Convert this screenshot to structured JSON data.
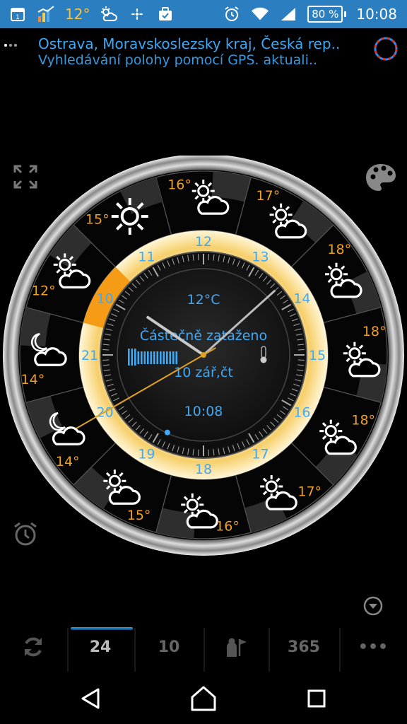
{
  "status_bar": {
    "notification_icons": [
      "calendar-icon",
      "weather-chart-icon",
      "fan-icon",
      "briefcase-icon"
    ],
    "temperature": "12°",
    "battery": "80 %",
    "time": "10:08"
  },
  "header": {
    "location": "Ostrava, Moravskoslezsky kraj, Česká rep..",
    "subtitle": "Vyhledávání polohy pomocí GPS. aktuali..",
    "page_count": 3,
    "active_page": 1
  },
  "clock": {
    "temperature": "12°C",
    "condition": "Částečně zataženo",
    "date": "10 zář,čt",
    "digital_time": "10:08",
    "hour_labels": [
      "12",
      "13",
      "14",
      "15",
      "16",
      "17",
      "18",
      "19",
      "20",
      "21",
      "10",
      "11"
    ],
    "hourly_forecast": [
      {
        "hour": "12",
        "temp": "16°",
        "icon": "partly-cloudy"
      },
      {
        "hour": "13",
        "temp": "17°",
        "icon": "partly-cloudy"
      },
      {
        "hour": "14",
        "temp": "18°",
        "icon": "partly-cloudy"
      },
      {
        "hour": "15",
        "temp": "18°",
        "icon": "partly-cloudy"
      },
      {
        "hour": "16",
        "temp": "18°",
        "icon": "partly-cloudy"
      },
      {
        "hour": "17",
        "temp": "17°",
        "icon": "partly-cloudy"
      },
      {
        "hour": "18",
        "temp": "16°",
        "icon": "partly-cloudy"
      },
      {
        "hour": "19",
        "temp": "15°",
        "icon": "partly-cloudy"
      },
      {
        "hour": "20",
        "temp": "14°",
        "icon": "moon-cloud"
      },
      {
        "hour": "21",
        "temp": "14°",
        "icon": "moon-cloud"
      },
      {
        "hour": "10",
        "temp": "12°",
        "icon": "partly-cloudy"
      },
      {
        "hour": "11",
        "temp": "15°",
        "icon": "sunny"
      }
    ],
    "hand_hour": 10,
    "hand_minute": 8,
    "hand_second": 40,
    "colors": {
      "accent": "#3fa9f5",
      "temp": "#f0a020",
      "second_hand": "#e0a020"
    }
  },
  "tabs": [
    {
      "label": "",
      "icon": "refresh-icon"
    },
    {
      "label": "24",
      "active": true
    },
    {
      "label": "10"
    },
    {
      "label": "",
      "icon": "user-flag-icon"
    },
    {
      "label": "365"
    },
    {
      "label": "•••",
      "icon": "more-icon"
    }
  ],
  "nav": [
    "back-icon",
    "home-icon",
    "recents-icon"
  ]
}
